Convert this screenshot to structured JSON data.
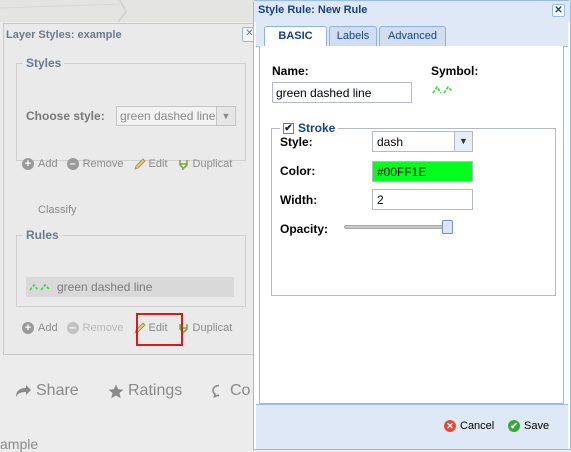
{
  "layer_styles": {
    "title": "Layer Styles: example",
    "close_glyph": "✕",
    "styles_legend": "Styles",
    "choose_style_label": "Choose style:",
    "choose_style_value": "green dashed line",
    "style_toolbar": {
      "add": "Add",
      "remove": "Remove",
      "edit": "Edit",
      "duplicate": "Duplicat"
    },
    "classify": "Classify",
    "rules_legend": "Rules",
    "rule_item": "green dashed line",
    "rules_toolbar": {
      "add": "Add",
      "remove": "Remove",
      "edit": "Edit",
      "duplicate": "Duplicat"
    }
  },
  "bottom_bar": {
    "share": "Share",
    "ratings": "Ratings",
    "comments_partial": "Co"
  },
  "page_fragment": "ample",
  "dialog": {
    "title": "Style Rule: New Rule",
    "close_glyph": "✕",
    "tabs": [
      {
        "label": "BASIC",
        "active": true
      },
      {
        "label": "Labels",
        "active": false
      },
      {
        "label": "Advanced",
        "active": false
      }
    ],
    "name_label": "Name:",
    "name_value": "green dashed line",
    "symbol_label": "Symbol:",
    "stroke": {
      "legend": "Stroke",
      "enabled": true,
      "style_label": "Style:",
      "style_value": "dash",
      "color_label": "Color:",
      "color_value": "#00FF1E",
      "width_label": "Width:",
      "width_value": "2",
      "opacity_label": "Opacity:",
      "opacity_level": 1.0
    },
    "footer": {
      "cancel": "Cancel",
      "save": "Save"
    }
  },
  "colors": {
    "stroke_color": "#00FF1E",
    "highlight": "#d81c1c",
    "dialog_title": "#15428b"
  }
}
